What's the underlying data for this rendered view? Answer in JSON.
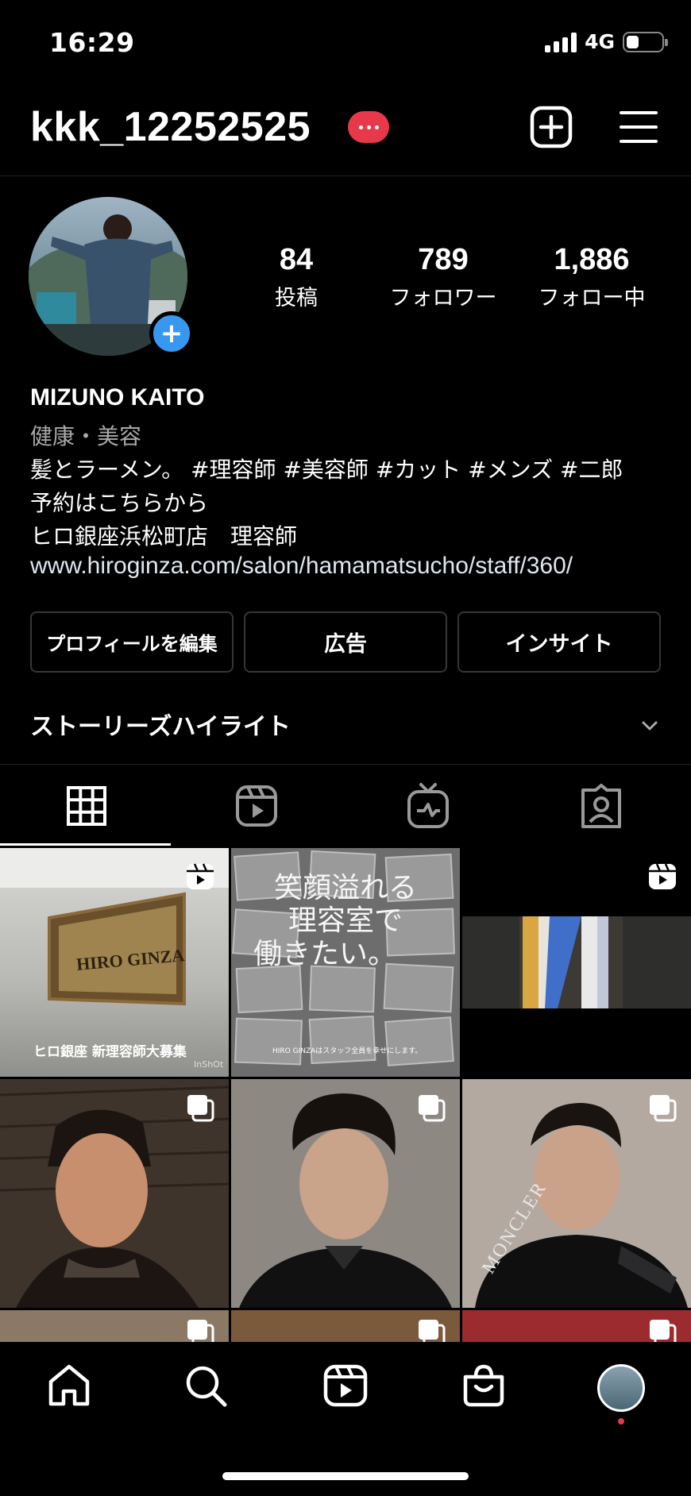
{
  "status": {
    "time": "16:29",
    "network": "4G",
    "battery_level": 0.35
  },
  "header": {
    "username": "kkk_12252525"
  },
  "profile": {
    "stats": [
      {
        "value": "84",
        "label": "投稿"
      },
      {
        "value": "789",
        "label": "フォロワー"
      },
      {
        "value": "1,886",
        "label": "フォロー中"
      }
    ],
    "display_name": "MIZUNO KAITO",
    "category": "健康・美容",
    "bio": [
      "髪とラーメン。 #理容師 #美容師 #カット #メンズ #二郎",
      "予約はこちらから",
      "ヒロ銀座浜松町店　理容師"
    ],
    "link": "www.hiroginza.com/salon/hamamatsucho/staff/360/"
  },
  "buttons": {
    "edit_profile": "プロフィールを編集",
    "ads": "広告",
    "insights": "インサイト"
  },
  "highlights": {
    "label": "ストーリーズハイライト"
  },
  "grid": {
    "post1": {
      "caption": "ヒロ銀座 新理容師大募集",
      "sign": "HIRO GINZA",
      "credit": "InShOt"
    },
    "post2": {
      "headline1": "笑顔溢れる",
      "headline2": "理容室で",
      "headline3": "働きたい。",
      "footer": "HIRO GINZAはスタッフ全員を幸せにします。"
    },
    "post5_text": "MONCLER"
  },
  "colors": {
    "accent_blue": "#3897f0",
    "badge_red": "#e8394a",
    "background": "#000000",
    "border": "#363636"
  }
}
